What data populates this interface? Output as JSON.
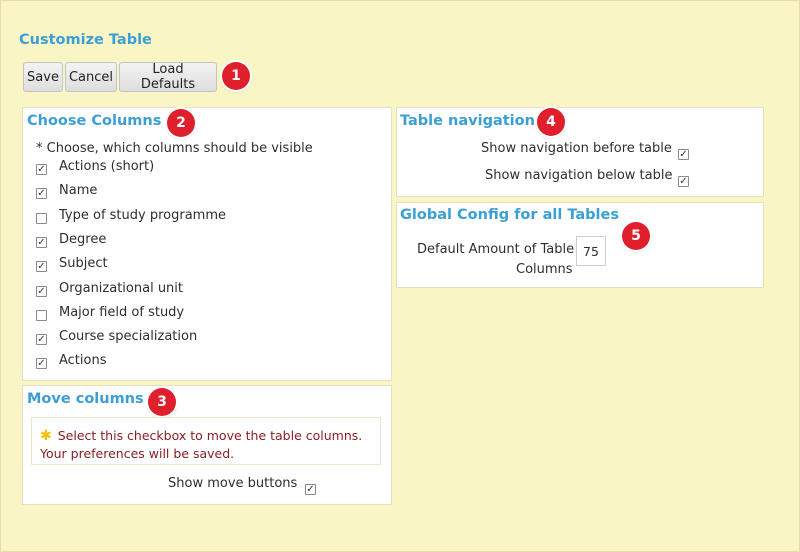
{
  "page": {
    "title": "Customize Table"
  },
  "toolbar": {
    "save": "Save",
    "cancel": "Cancel",
    "load_defaults": "Load Defaults"
  },
  "badges": [
    "1",
    "2",
    "3",
    "4",
    "5"
  ],
  "choose_columns": {
    "title": "Choose Columns",
    "hint": "* Choose, which columns should be visible",
    "items": [
      {
        "label": "Actions (short)",
        "checked": true
      },
      {
        "label": "Name",
        "checked": true
      },
      {
        "label": "Type of study programme",
        "checked": false
      },
      {
        "label": "Degree",
        "checked": true
      },
      {
        "label": "Subject",
        "checked": true
      },
      {
        "label": "Organizational unit",
        "checked": true
      },
      {
        "label": "Major field of study",
        "checked": false
      },
      {
        "label": "Course specialization",
        "checked": true
      },
      {
        "label": "Actions",
        "checked": true
      }
    ]
  },
  "move_columns": {
    "title": "Move columns",
    "note": "Select this checkbox to move the table columns. Your preferences will be saved.",
    "show_move_buttons": "Show move buttons",
    "show_move_buttons_checked": true
  },
  "table_navigation": {
    "title": "Table navigation",
    "before_label": "Show navigation before table",
    "before_checked": true,
    "below_label": "Show navigation below table",
    "below_checked": true
  },
  "global_config": {
    "title": "Global Config for all Tables",
    "amount_label_line1": "Default Amount of Table",
    "amount_label_line2": "Columns",
    "amount_value": "75"
  },
  "colors": {
    "accent": "#3b9fd6",
    "badge": "#e01f2d",
    "background": "#faf5c4",
    "note_text": "#8a1f24"
  }
}
